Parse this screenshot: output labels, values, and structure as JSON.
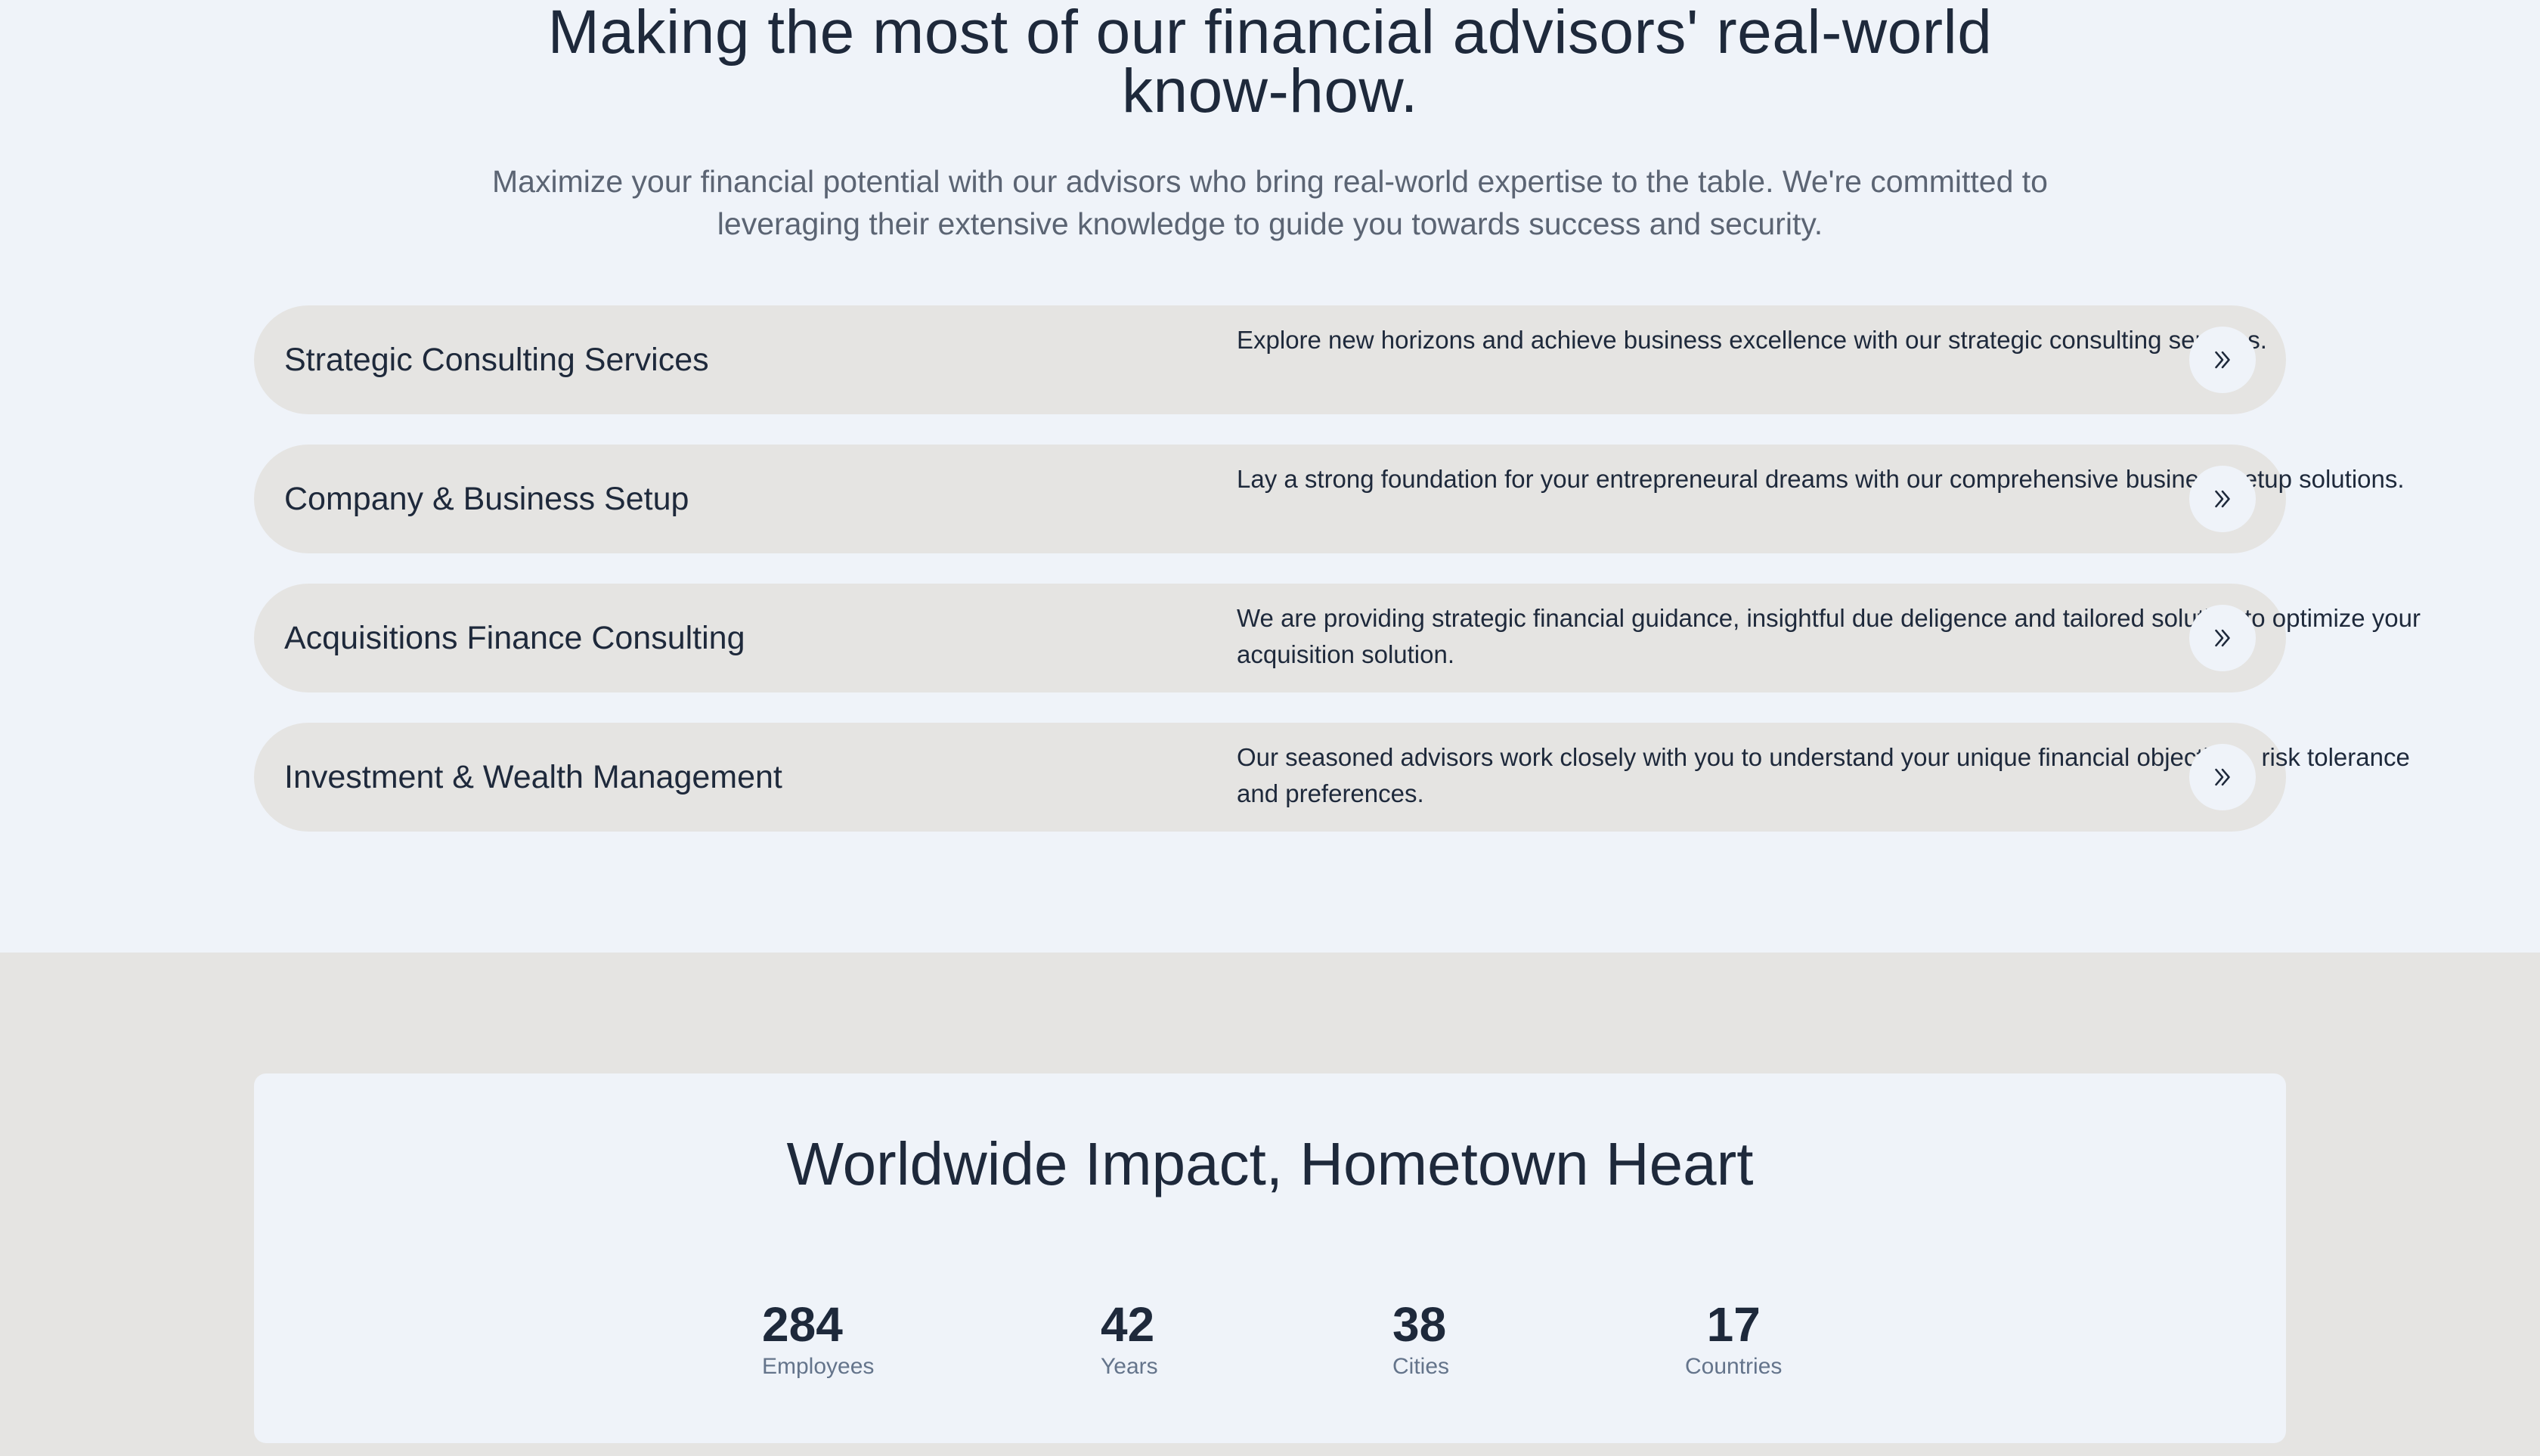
{
  "services_section": {
    "heading": "Making the most of our financial advisors' real-world know-how.",
    "subheading": "Maximize your financial potential with our advisors who bring real-world expertise to the table. We're committed to leveraging their extensive knowledge to guide you towards success and security.",
    "services": [
      {
        "title": "Strategic Consulting Services",
        "description": "Explore new horizons and achieve business excellence with our strategic consulting services.",
        "icon": "double-chevron-right-icon"
      },
      {
        "title": "Company & Business Setup",
        "description": "Lay a strong foundation for your entrepreneural dreams with our comprehensive business setup solutions.",
        "icon": "double-chevron-right-icon"
      },
      {
        "title": "Acquisitions Finance Consulting",
        "description": "We are providing strategic financial guidance, insightful due deligence and tailored solution to optimize your acquisition solution.",
        "icon": "double-chevron-right-icon"
      },
      {
        "title": "Investment & Wealth Management",
        "description": "Our seasoned advisors work closely with you to understand your unique financial objectives, risk tolerance and preferences.",
        "icon": "double-chevron-right-icon"
      }
    ]
  },
  "impact_section": {
    "title": "Worldwide Impact, Hometown Heart",
    "stats": [
      {
        "value": "284",
        "label": "Employees"
      },
      {
        "value": "42",
        "label": "Years"
      },
      {
        "value": "38",
        "label": "Cities"
      },
      {
        "value": "17",
        "label": "Countries"
      }
    ]
  },
  "colors": {
    "page_background": "#eff3f9",
    "row_background": "#e5e4e2",
    "text_primary": "#1e293b",
    "text_secondary": "#5b6473"
  }
}
